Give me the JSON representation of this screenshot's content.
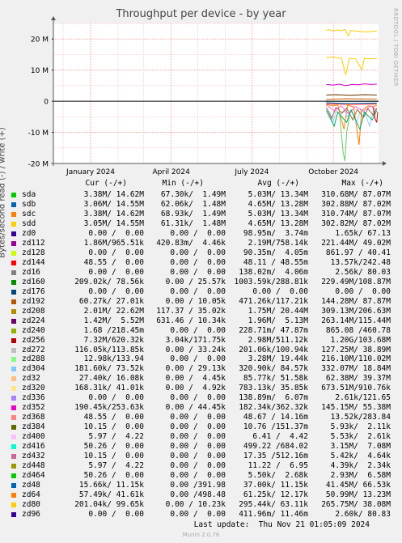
{
  "chart_data": {
    "type": "line",
    "title": "Throughput per device - by year",
    "ylabel": "Bytes/second read (-) / write (+)",
    "ylim": [
      -20000000,
      25000000
    ],
    "yticks": [
      {
        "value": 20000000,
        "label": "20 M"
      },
      {
        "value": 10000000,
        "label": "10 M"
      },
      {
        "value": 0,
        "label": "0"
      },
      {
        "value": -10000000,
        "label": "-10 M"
      },
      {
        "value": -20000000,
        "label": "-20 M"
      }
    ],
    "xrange": [
      "2023-11-20",
      "2024-11-21"
    ],
    "xticks": [
      {
        "date": "2024-01-01",
        "label": "January 2024"
      },
      {
        "date": "2024-04-01",
        "label": "April 2024"
      },
      {
        "date": "2024-07-01",
        "label": "July 2024"
      },
      {
        "date": "2024-10-01",
        "label": "October 2024"
      }
    ],
    "grid": true,
    "data_start": "2024-09-22",
    "series_traces": [
      {
        "name": "sda",
        "color": "#00cc00",
        "points": [
          [
            "2024-09-22",
            0
          ],
          [
            "2024-11-21",
            0
          ]
        ]
      },
      {
        "name": "zd0",
        "color": "#330099",
        "points": [
          [
            "2024-09-22",
            0
          ],
          [
            "2024-11-21",
            0
          ]
        ]
      },
      {
        "name": "sdd",
        "color": "#ffcc00",
        "points": [
          [
            "2024-09-23",
            22800000
          ],
          [
            "2024-09-26",
            23000000
          ],
          [
            "2024-10-01",
            22600000
          ],
          [
            "2024-10-06",
            22900000
          ],
          [
            "2024-10-10",
            22700000
          ],
          [
            "2024-10-14",
            23100000
          ],
          [
            "2024-10-18",
            21000000
          ],
          [
            "2024-10-21",
            22800000
          ],
          [
            "2024-10-28",
            22500000
          ],
          [
            "2024-11-05",
            22300000
          ],
          [
            "2024-11-12",
            22400000
          ],
          [
            "2024-11-19",
            22600000
          ]
        ]
      },
      {
        "name": "sdd",
        "color": "#ffcc00",
        "points": [
          [
            "2024-09-23",
            14000000
          ],
          [
            "2024-09-28",
            14200000
          ],
          [
            "2024-10-04",
            14000000
          ],
          [
            "2024-10-10",
            13900000
          ],
          [
            "2024-10-15",
            8500000
          ],
          [
            "2024-10-19",
            13800000
          ],
          [
            "2024-10-26",
            13600000
          ],
          [
            "2024-11-02",
            10200000
          ],
          [
            "2024-11-05",
            13800000
          ],
          [
            "2024-11-12",
            13600000
          ],
          [
            "2024-11-19",
            13800000
          ]
        ]
      },
      {
        "name": "zd352",
        "color": "#cc00cc",
        "points": [
          [
            "2024-09-23",
            5400000
          ],
          [
            "2024-10-01",
            5200000
          ],
          [
            "2024-10-08",
            5500000
          ],
          [
            "2024-10-15",
            5000000
          ],
          [
            "2024-10-22",
            5400000
          ],
          [
            "2024-10-29",
            5300000
          ],
          [
            "2024-11-05",
            5600000
          ],
          [
            "2024-11-12",
            5400000
          ],
          [
            "2024-11-19",
            5500000
          ]
        ]
      },
      {
        "name": "zd224",
        "color": "#663300",
        "points": [
          [
            "2024-09-23",
            2000000
          ],
          [
            "2024-10-05",
            2100000
          ],
          [
            "2024-10-20",
            1900000
          ],
          [
            "2024-11-05",
            2100000
          ],
          [
            "2024-11-19",
            2000000
          ]
        ]
      },
      {
        "name": "zd192",
        "color": "#cc6600",
        "points": [
          [
            "2024-09-23",
            600000
          ],
          [
            "2024-10-15",
            800000
          ],
          [
            "2024-11-19",
            700000
          ]
        ]
      },
      {
        "name": "sdc",
        "color": "#ff8000",
        "points": [
          [
            "2024-09-23",
            -1000000
          ],
          [
            "2024-09-30",
            -1500000
          ],
          [
            "2024-10-06",
            -1200000
          ],
          [
            "2024-10-13",
            -9000000
          ],
          [
            "2024-10-17",
            -1300000
          ],
          [
            "2024-10-24",
            -1800000
          ],
          [
            "2024-10-30",
            -14000000
          ],
          [
            "2024-11-02",
            -3000000
          ],
          [
            "2024-11-09",
            -1500000
          ],
          [
            "2024-11-15",
            -1700000
          ],
          [
            "2024-11-19",
            -1400000
          ]
        ]
      },
      {
        "name": "zd304",
        "color": "#99ccff",
        "points": [
          [
            "2024-09-23",
            -2500000
          ],
          [
            "2024-09-27",
            -3500000
          ],
          [
            "2024-10-01",
            -6500000
          ],
          [
            "2024-10-04",
            -3000000
          ],
          [
            "2024-10-09",
            -4500000
          ],
          [
            "2024-10-13",
            -2800000
          ],
          [
            "2024-10-17",
            -5000000
          ],
          [
            "2024-10-22",
            -3000000
          ],
          [
            "2024-10-27",
            -7000000
          ],
          [
            "2024-11-01",
            -2500000
          ],
          [
            "2024-11-06",
            -4200000
          ],
          [
            "2024-11-11",
            -8000000
          ],
          [
            "2024-11-15",
            -3200000
          ],
          [
            "2024-11-19",
            -2600000
          ]
        ]
      },
      {
        "name": "zd448",
        "color": "#996633",
        "points": [
          [
            "2024-09-23",
            -2000000
          ],
          [
            "2024-09-29",
            -5500000
          ],
          [
            "2024-10-04",
            -2000000
          ],
          [
            "2024-10-11",
            -3800000
          ],
          [
            "2024-10-16",
            -2200000
          ],
          [
            "2024-10-23",
            -6000000
          ],
          [
            "2024-10-28",
            -2600000
          ],
          [
            "2024-11-04",
            -5200000
          ],
          [
            "2024-11-09",
            -2400000
          ],
          [
            "2024-11-15",
            -4500000
          ],
          [
            "2024-11-19",
            -2200000
          ]
        ]
      },
      {
        "name": "zd416",
        "color": "#ff66cc",
        "points": [
          [
            "2024-09-23",
            -1200000
          ],
          [
            "2024-10-02",
            -3000000
          ],
          [
            "2024-10-10",
            -1500000
          ],
          [
            "2024-10-18",
            -4000000
          ],
          [
            "2024-10-26",
            -1700000
          ],
          [
            "2024-11-04",
            -3200000
          ],
          [
            "2024-11-12",
            -1500000
          ],
          [
            "2024-11-19",
            -2800000
          ]
        ]
      },
      {
        "name": "zd288",
        "color": "#00aa66",
        "points": [
          [
            "2024-09-23",
            -3000000
          ],
          [
            "2024-10-02",
            -8000000
          ],
          [
            "2024-10-06",
            -3500000
          ],
          [
            "2024-10-16",
            -6800000
          ],
          [
            "2024-10-21",
            -2800000
          ],
          [
            "2024-10-31",
            -9000000
          ],
          [
            "2024-11-05",
            -3500000
          ],
          [
            "2024-11-14",
            -6000000
          ],
          [
            "2024-11-19",
            -3000000
          ]
        ]
      },
      {
        "name": "zd464",
        "color": "#66cc66",
        "points": [
          [
            "2024-10-08",
            -4000000
          ],
          [
            "2024-10-12",
            -16500000
          ],
          [
            "2024-10-14",
            -19200000
          ],
          [
            "2024-10-16",
            -10000000
          ],
          [
            "2024-10-19",
            -5000000
          ]
        ]
      },
      {
        "name": "zd432",
        "color": "#cc0000",
        "points": [
          [
            "2024-11-15",
            -2000000
          ],
          [
            "2024-11-17",
            -5500000
          ],
          [
            "2024-11-19",
            -6800000
          ],
          [
            "2024-11-20",
            -3500000
          ]
        ]
      },
      {
        "name": "sdb",
        "color": "#0066b3",
        "points": [
          [
            "2024-09-23",
            -500000
          ],
          [
            "2024-10-15",
            -700000
          ],
          [
            "2024-11-19",
            -600000
          ]
        ]
      },
      {
        "name": "zd256",
        "color": "#ff3333",
        "points": [
          [
            "2024-09-23",
            -800000
          ],
          [
            "2024-10-20",
            -1100000
          ],
          [
            "2024-11-19",
            -900000
          ]
        ]
      }
    ],
    "columns": [
      "Cur (-/+)",
      "Min (-/+)",
      "Avg (-/+)",
      "Max (-/+)"
    ],
    "series": [
      {
        "name": "sda",
        "color": "#00cc00",
        "cur": "3.38M/ 14.62M",
        "min": "67.30k/  1.49M",
        "avg": "5.03M/ 13.34M",
        "max": "310.68M/ 87.07M"
      },
      {
        "name": "sdb",
        "color": "#0066b3",
        "cur": "3.06M/ 14.55M",
        "min": "62.06k/  1.48M",
        "avg": "4.65M/ 13.28M",
        "max": "302.88M/ 87.02M"
      },
      {
        "name": "sdc",
        "color": "#ff8000",
        "cur": "3.38M/ 14.62M",
        "min": "68.93k/  1.49M",
        "avg": "5.03M/ 13.34M",
        "max": "310.74M/ 87.07M"
      },
      {
        "name": "sdd",
        "color": "#ffcc00",
        "cur": "3.05M/ 14.55M",
        "min": "61.31k/  1.48M",
        "avg": "4.65M/ 13.28M",
        "max": "302.82M/ 87.02M"
      },
      {
        "name": "zd0",
        "color": "#330099",
        "cur": "0.00 /  0.00",
        "min": "0.00 /  0.00",
        "avg": "98.95m/  3.74m",
        "max": "1.65k/ 67.13"
      },
      {
        "name": "zd112",
        "color": "#990099",
        "cur": "1.86M/965.51k",
        "min": "420.83m/  4.46k",
        "avg": "2.19M/758.14k",
        "max": "221.44M/ 49.02M"
      },
      {
        "name": "zd128",
        "color": "#ccff00",
        "cur": "0.00 /  0.00",
        "min": "0.00 /  0.00",
        "avg": "90.35m/  4.05m",
        "max": "861.97 / 40.41"
      },
      {
        "name": "zd144",
        "color": "#ff0000",
        "cur": "48.55 /  0.00",
        "min": "0.00 /  0.00",
        "avg": "48.11 / 48.55m",
        "max": "13.57k/242.48"
      },
      {
        "name": "zd16",
        "color": "#808080",
        "cur": "0.00 /  0.00",
        "min": "0.00 /  0.00",
        "avg": "138.02m/  4.06m",
        "max": "2.56k/ 80.03"
      },
      {
        "name": "zd160",
        "color": "#008f00",
        "cur": "209.02k/ 78.56k",
        "min": "0.00 / 25.57k",
        "avg": "1003.59k/288.81k",
        "max": "229.49M/108.87M"
      },
      {
        "name": "zd176",
        "color": "#00487d",
        "cur": "0.00 /  0.00",
        "min": "0.00 /  0.00",
        "avg": "0.00 /  0.00",
        "max": "0.00 /  0.00"
      },
      {
        "name": "zd192",
        "color": "#b35a00",
        "cur": "60.27k/ 27.01k",
        "min": "0.00 / 10.05k",
        "avg": "471.26k/117.21k",
        "max": "144.28M/ 87.87M"
      },
      {
        "name": "zd208",
        "color": "#b38f00",
        "cur": "2.01M/ 22.62M",
        "min": "117.37 / 35.02k",
        "avg": "1.75M/ 20.44M",
        "max": "309.13M/206.63M"
      },
      {
        "name": "zd224",
        "color": "#6b006b",
        "cur": "1.42M/  5.52M",
        "min": "631.46 / 10.34k",
        "avg": "1.96M/  5.13M",
        "max": "263.14M/115.44M"
      },
      {
        "name": "zd240",
        "color": "#8fb300",
        "cur": "1.68 /218.45m",
        "min": "0.00 /  0.00",
        "avg": "228.71m/ 47.87m",
        "max": "865.08 /460.78"
      },
      {
        "name": "zd256",
        "color": "#b30000",
        "cur": "7.32M/620.32k",
        "min": "3.04k/171.75k",
        "avg": "2.98M/511.12k",
        "max": "1.20G/103.68M"
      },
      {
        "name": "zd272",
        "color": "#bebebe",
        "cur": "116.05k/113.85k",
        "min": "0.00 / 33.24k",
        "avg": "201.06k/100.94k",
        "max": "127.25M/ 38.89M"
      },
      {
        "name": "zd288",
        "color": "#80ff80",
        "cur": "12.98k/133.94",
        "min": "0.00 /  0.00",
        "avg": "3.28M/ 19.44k",
        "max": "216.10M/110.02M"
      },
      {
        "name": "zd304",
        "color": "#80c9ff",
        "cur": "181.60k/ 73.52k",
        "min": "0.00 / 29.13k",
        "avg": "320.90k/ 84.57k",
        "max": "332.07M/ 18.84M"
      },
      {
        "name": "zd32",
        "color": "#ffc080",
        "cur": "27.40k/ 16.08k",
        "min": "0.00 /  4.45k",
        "avg": "85.77k/ 51.58k",
        "max": "62.38M/ 39.37M"
      },
      {
        "name": "zd320",
        "color": "#ffe680",
        "cur": "168.31k/ 41.01k",
        "min": "0.00 /  4.92k",
        "avg": "783.13k/ 35.85k",
        "max": "673.51M/910.76k"
      },
      {
        "name": "zd336",
        "color": "#aa80ff",
        "cur": "0.00 /  0.00",
        "min": "0.00 /  0.00",
        "avg": "138.89m/  6.07m",
        "max": "2.61k/121.65"
      },
      {
        "name": "zd352",
        "color": "#ee00cc",
        "cur": "190.45k/253.63k",
        "min": "0.00 / 44.45k",
        "avg": "182.34k/362.32k",
        "max": "145.15M/ 55.38M"
      },
      {
        "name": "zd368",
        "color": "#ff8080",
        "cur": "48.55 /  0.00",
        "min": "0.00 /  0.00",
        "avg": "48.67 / 14.16m",
        "max": "13.52k/283.84"
      },
      {
        "name": "zd384",
        "color": "#666600",
        "cur": "10.15 /  0.00",
        "min": "0.00 /  0.00",
        "avg": "10.76 /151.37m",
        "max": "5.93k/  2.11k"
      },
      {
        "name": "zd400",
        "color": "#ffbfff",
        "cur": "5.97 /  4.22",
        "min": "0.00 /  0.00",
        "avg": "6.41 /  4.42",
        "max": "5.53k/  2.61k"
      },
      {
        "name": "zd416",
        "color": "#00ffcc",
        "cur": "50.26 /  0.00",
        "min": "0.00 /  0.00",
        "avg": "499.22 /684.02",
        "max": "3.15M/  7.08M"
      },
      {
        "name": "zd432",
        "color": "#cc6699",
        "cur": "10.15 /  0.00",
        "min": "0.00 /  0.00",
        "avg": "17.35 /512.16m",
        "max": "5.42k/  4.64k"
      },
      {
        "name": "zd448",
        "color": "#999900",
        "cur": "5.97 /  4.22",
        "min": "0.00 /  0.00",
        "avg": "11.22 /  6.95",
        "max": "4.39k/  2.34k"
      },
      {
        "name": "zd464",
        "color": "#00cc00",
        "cur": "50.26 /  0.00",
        "min": "0.00 /  0.00",
        "avg": "5.50k/  2.68k",
        "max": "2.93M/  6.58M"
      },
      {
        "name": "zd48",
        "color": "#0066b3",
        "cur": "15.66k/ 11.15k",
        "min": "0.00 /391.98",
        "avg": "37.00k/ 11.15k",
        "max": "41.45M/ 66.53k"
      },
      {
        "name": "zd64",
        "color": "#ff8000",
        "cur": "57.49k/ 41.61k",
        "min": "0.00 /498.48",
        "avg": "61.25k/ 12.17k",
        "max": "50.99M/ 13.23M"
      },
      {
        "name": "zd80",
        "color": "#ffcc00",
        "cur": "201.04k/ 99.65k",
        "min": "0.00 / 10.23k",
        "avg": "295.44k/ 63.11k",
        "max": "265.75M/ 38.08M"
      },
      {
        "name": "zd96",
        "color": "#330099",
        "cur": "0.00 /  0.00",
        "min": "0.00 /  0.00",
        "avg": "411.96m/ 11.46m",
        "max": "2.60k/ 80.83"
      }
    ]
  },
  "last_update": "Last update:  Thu Nov 21 01:05:09 2024",
  "footer": "Munin 2.0.76",
  "side_tag": "RRDTOOL / TOBI OETIKER"
}
